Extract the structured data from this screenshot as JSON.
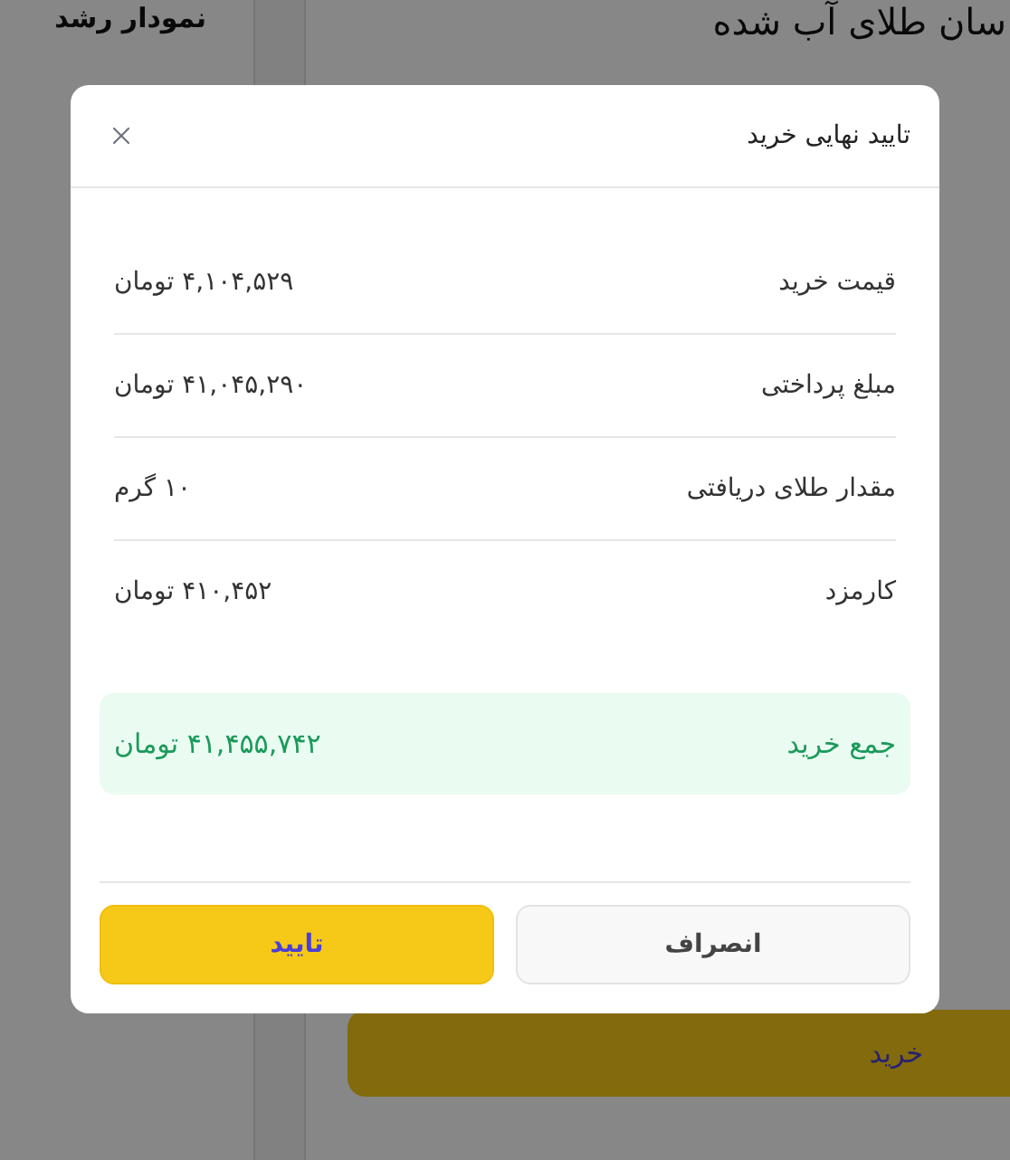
{
  "page": {
    "title": "سان طلای آب شده",
    "side_title": "نمودار رشد",
    "buy_button": "خرید"
  },
  "dialog": {
    "title": "تایید نهایی خرید",
    "rows": [
      {
        "label": "قیمت خرید",
        "value": "۴,۱۰۴,۵۲۹ تومان"
      },
      {
        "label": "مبلغ پرداختی",
        "value": "۴۱,۰۴۵,۲۹۰ تومان"
      },
      {
        "label": "مقدار طلای دریافتی",
        "value": "۱۰ گرم"
      },
      {
        "label": "کارمزد",
        "value": "۴۱۰,۴۵۲ تومان"
      }
    ],
    "total": {
      "label": "جمع خرید",
      "value": "۴۱,۴۵۵,۷۴۲ تومان"
    },
    "buttons": [
      {
        "label": "انصراف",
        "kind": "secondary"
      },
      {
        "label": "تایید",
        "kind": "primary"
      }
    ]
  }
}
